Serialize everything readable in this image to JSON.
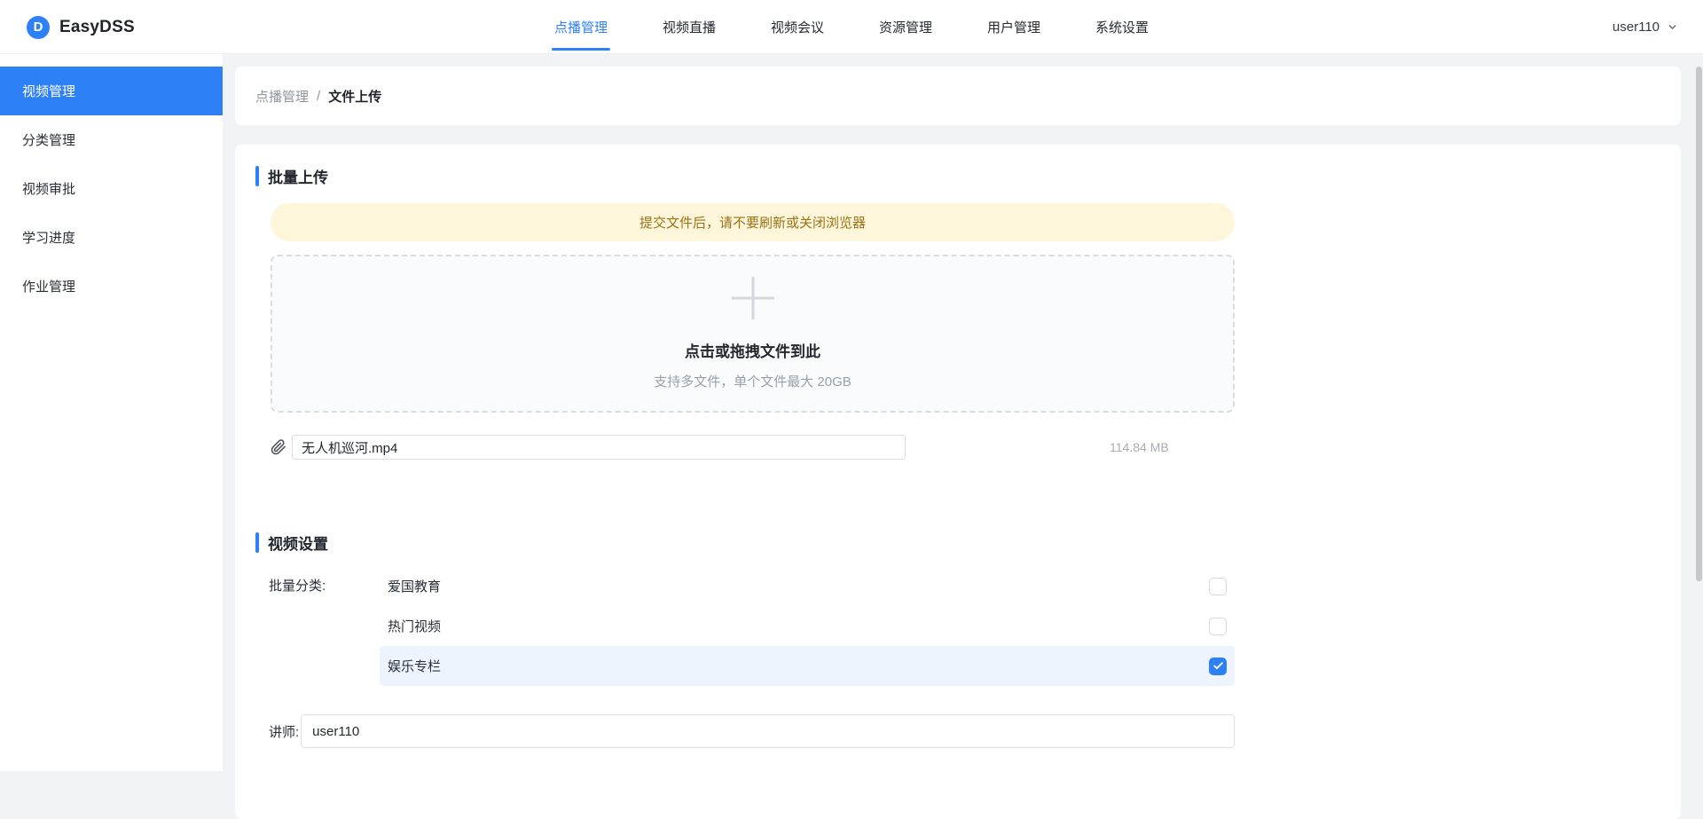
{
  "brand": {
    "name": "EasyDSS",
    "logo_letter": "D"
  },
  "navbar": {
    "items": [
      {
        "label": "点播管理",
        "active": true
      },
      {
        "label": "视频直播",
        "active": false
      },
      {
        "label": "视频会议",
        "active": false
      },
      {
        "label": "资源管理",
        "active": false
      },
      {
        "label": "用户管理",
        "active": false
      },
      {
        "label": "系统设置",
        "active": false
      }
    ],
    "user": {
      "name": "user110"
    }
  },
  "sidebar": {
    "items": [
      {
        "label": "视频管理",
        "active": true
      },
      {
        "label": "分类管理",
        "active": false
      },
      {
        "label": "视频审批",
        "active": false
      },
      {
        "label": "学习进度",
        "active": false
      },
      {
        "label": "作业管理",
        "active": false
      }
    ]
  },
  "breadcrumb": {
    "parent": "点播管理",
    "separator": "/",
    "current": "文件上传"
  },
  "upload_section": {
    "title": "批量上传",
    "warning": "提交文件后，请不要刷新或关闭浏览器",
    "dropzone": {
      "main_text": "点击或拖拽文件到此",
      "sub_text": "支持多文件，单个文件最大 20GB"
    },
    "file": {
      "name": "无人机巡河.mp4",
      "size": "114.84 MB"
    }
  },
  "settings_section": {
    "title": "视频设置",
    "category_label": "批量分类:",
    "categories": [
      {
        "label": "爱国教育",
        "checked": false
      },
      {
        "label": "热门视频",
        "checked": false
      },
      {
        "label": "娱乐专栏",
        "checked": true
      }
    ],
    "teacher_label": "讲师:",
    "teacher_value": "user110"
  },
  "icons": {
    "logo": "easydss-logo",
    "user_dropdown": "chevron-down-icon",
    "attach": "paperclip-icon",
    "upload": "plus-icon",
    "checked": "check-icon"
  },
  "colors": {
    "accent_blue": "#2e80f7",
    "warning_bg": "#fdf6da",
    "warning_text": "#9c7216",
    "page_bg": "#f2f3f5",
    "checked_row_bg": "#edf4fe"
  }
}
